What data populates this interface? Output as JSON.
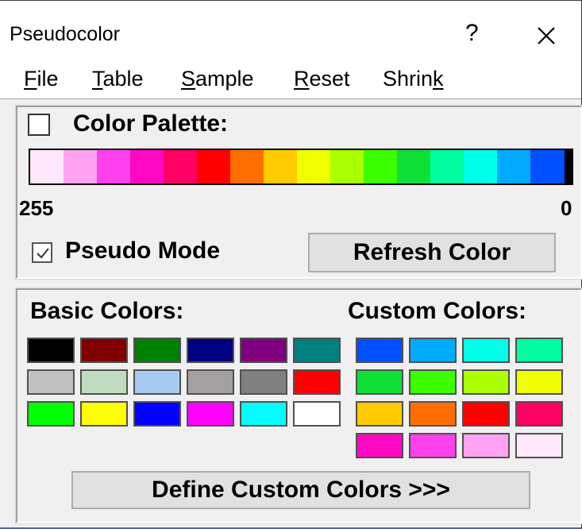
{
  "window": {
    "title": "Pseudocolor",
    "help": "?",
    "close_icon": "close-icon"
  },
  "menu": [
    {
      "pre": "",
      "u": "F",
      "post": "ile"
    },
    {
      "pre": "",
      "u": "T",
      "post": "able"
    },
    {
      "pre": "",
      "u": "S",
      "post": "ample"
    },
    {
      "pre": "",
      "u": "R",
      "post": "eset"
    },
    {
      "pre": "Shrin",
      "u": "k",
      "post": ""
    }
  ],
  "palette": {
    "label": "Color Palette:",
    "checked": false,
    "max_label": "255",
    "min_label": "0",
    "gradient": [
      "#ffe8fb",
      "#ffa3f2",
      "#ff40ef",
      "#ff08c4",
      "#ff0063",
      "#ff0000",
      "#ff6f00",
      "#ffca00",
      "#f0ff00",
      "#aaff00",
      "#3cff00",
      "#0fe038",
      "#00ffa0",
      "#00ffe8",
      "#00aaff",
      "#0050ff"
    ]
  },
  "pseudo_mode": {
    "label": "Pseudo Mode",
    "checked": true
  },
  "buttons": {
    "refresh": "Refresh Color",
    "define": "Define Custom Colors >>>"
  },
  "basic_colors": {
    "label": "Basic Colors:",
    "rows": [
      [
        "#000000",
        "#800000",
        "#008000",
        "#000080",
        "#800080",
        "#008080"
      ],
      [
        "#c0c0c0",
        "#c0dcc0",
        "#a6caf0",
        "#a4a0a0",
        "#808080",
        "#ff0000"
      ],
      [
        "#00ff00",
        "#ffff00",
        "#0000ff",
        "#ff00ff",
        "#00ffff",
        "#ffffff"
      ]
    ]
  },
  "custom_colors": {
    "label": "Custom Colors:",
    "rows": [
      [
        "#0050ff",
        "#00aaff",
        "#00ffe8",
        "#00ffa0"
      ],
      [
        "#0fe038",
        "#3cff00",
        "#aaff00",
        "#f0ff00"
      ],
      [
        "#ffca00",
        "#ff6f00",
        "#ff0000",
        "#ff0063"
      ],
      [
        "#ff08c4",
        "#ff40ef",
        "#ffa3f2",
        "#ffe8fb"
      ]
    ]
  }
}
